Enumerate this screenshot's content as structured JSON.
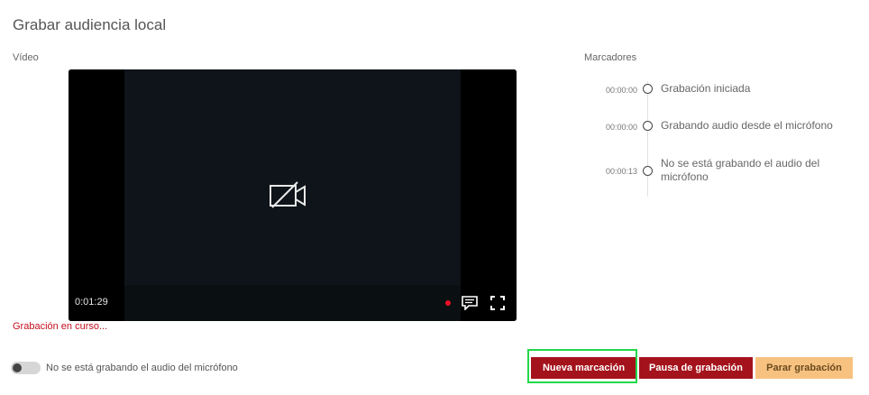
{
  "page": {
    "title": "Grabar audiencia local"
  },
  "video": {
    "label": "Vídeo",
    "elapsed": "0:01:29",
    "status": "Grabación en curso..."
  },
  "markers": {
    "label": "Marcadores",
    "items": [
      {
        "time": "00:00:00",
        "text": "Grabación iniciada"
      },
      {
        "time": "00:00:00",
        "text": "Grabando audio desde el micrófono"
      },
      {
        "time": "00:00:13",
        "text": "No se está grabando el audio del micrófono"
      }
    ]
  },
  "mic": {
    "label": "No se está grabando el audio del micrófono",
    "enabled": false
  },
  "actions": {
    "new_marker": "Nueva marcación",
    "pause": "Pausa de grabación",
    "stop": "Parar grabación"
  },
  "colors": {
    "primary": "#a4131b",
    "secondary": "#f7c280",
    "recording": "#e81123",
    "focus": "#21d84a"
  }
}
